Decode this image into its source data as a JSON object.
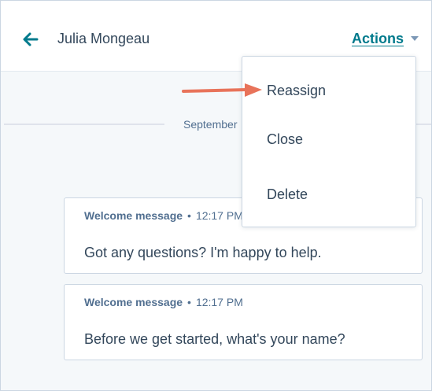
{
  "header": {
    "back_icon": "arrow-left-icon",
    "contact_name": "Julia Mongeau",
    "actions_label": "Actions",
    "actions_caret_icon": "caret-down-icon"
  },
  "date_divider": {
    "label": "September"
  },
  "messages": [
    {
      "sender": "Welcome message",
      "separator": "•",
      "time": "12:17 PM",
      "text": "Got any questions? I'm happy to help."
    },
    {
      "sender": "Welcome message",
      "separator": "•",
      "time": "12:17 PM",
      "text": "Before we get started, what's your name?"
    }
  ],
  "actions_menu": {
    "items": [
      {
        "label": "Reassign"
      },
      {
        "label": "Close"
      },
      {
        "label": "Delete"
      }
    ]
  },
  "annotation": {
    "icon": "arrow-right-icon"
  },
  "colors": {
    "accent": "#007a8c",
    "text": "#33475b",
    "muted": "#516f90",
    "border": "#cbd6e2",
    "background": "#f5f8fa",
    "annotation": "#e8735a"
  }
}
